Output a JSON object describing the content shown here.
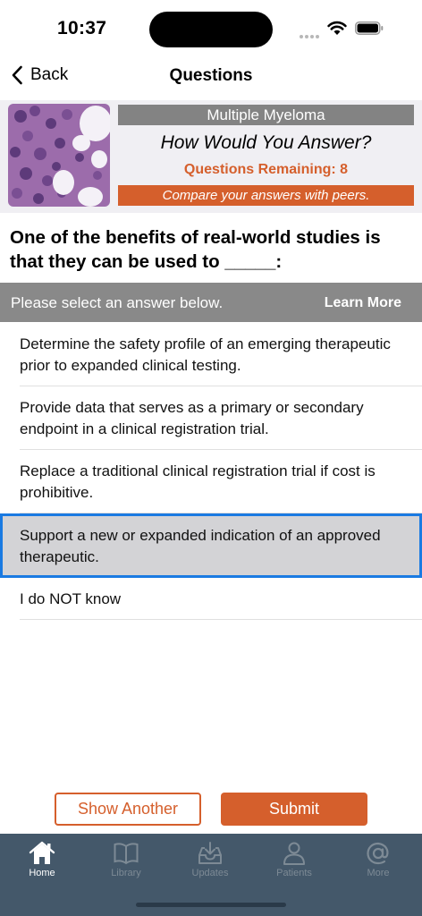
{
  "status_bar": {
    "time": "10:37"
  },
  "nav": {
    "back_label": "Back",
    "title": "Questions"
  },
  "banner": {
    "topic": "Multiple Myeloma",
    "heading": "How Would You Answer?",
    "remaining": "Questions Remaining: 8",
    "compare": "Compare your answers with peers."
  },
  "question": {
    "text": "One of the benefits of real-world studies is that they can be used to _____:"
  },
  "prompt": {
    "instruction": "Please select an answer below.",
    "learn_more": "Learn More"
  },
  "answers": [
    {
      "text": "Determine the safety profile of an emerging therapeutic prior to expanded clinical testing.",
      "selected": false
    },
    {
      "text": "Provide data that serves as a primary or secondary endpoint in a clinical registration trial.",
      "selected": false
    },
    {
      "text": "Replace a traditional clinical registration trial if cost is prohibitive.",
      "selected": false
    },
    {
      "text": "Support a new or expanded indication of an approved therapeutic.",
      "selected": true
    },
    {
      "text": "I do NOT know",
      "selected": false
    }
  ],
  "actions": {
    "show_another": "Show Another",
    "submit": "Submit"
  },
  "tabs": [
    {
      "label": "Home",
      "icon": "home-icon",
      "active": true
    },
    {
      "label": "Library",
      "icon": "book-icon",
      "active": false
    },
    {
      "label": "Updates",
      "icon": "inbox-download-icon",
      "active": false
    },
    {
      "label": "Patients",
      "icon": "person-icon",
      "active": false
    },
    {
      "label": "More",
      "icon": "at-icon",
      "active": false
    }
  ],
  "colors": {
    "accent": "#d55f2c",
    "selection": "#1a7ae2",
    "tab_bar": "#44586a",
    "header_gray": "#898989"
  }
}
